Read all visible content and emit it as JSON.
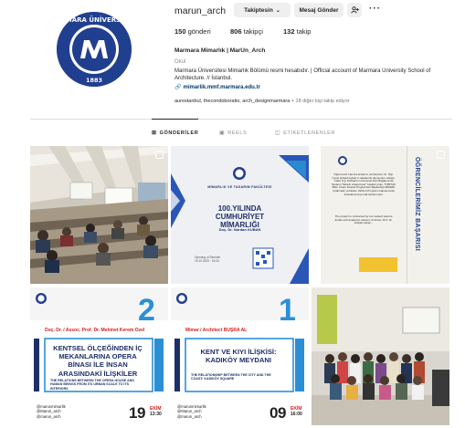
{
  "profile": {
    "username": "marun_arch",
    "follow_label": "Takiptesin",
    "message_label": "Mesaj Gönder",
    "add_user_icon": "add-user-icon",
    "more_label": "···",
    "stats": {
      "posts_count": "150",
      "posts_label": "gönderi",
      "followers_count": "806",
      "followers_label": "takipçi",
      "following_count": "132",
      "following_label": "takip"
    },
    "display_name": "Marmara Mimarlık | MarUn_Arch",
    "category": "Okul",
    "bio": "Marmara Üniversitesi Mimarlık Bölümü resmi hesabıdır. | Official account of Marmara University School of Architecture. // İstanbul.",
    "link": "mimarlik.mmf.marmara.edu.tr",
    "followed_by": "aurestanbul, thecondoboratio, arch_designmarmara",
    "followed_by_more": " + 18 diğer kişi takip ediyor"
  },
  "tabs": [
    {
      "label": "GÖNDERİLER",
      "icon": "grid-icon",
      "active": true
    },
    {
      "label": "REELS",
      "icon": "reels-icon",
      "active": false
    },
    {
      "label": "ETİKETLENENLER",
      "icon": "tagged-icon",
      "active": false
    }
  ],
  "posts": {
    "p2": {
      "faculty": "MİMARLIK VE TASARIM FAKÜLTESİ",
      "title_line1": "100.YILINDA",
      "title_line2": "CUMHURİYET",
      "title_line3": "MİMARLIĞI",
      "author": "Doç. Dr. Nurdan KUBAN",
      "date_line1": "Opening of Seminer",
      "date_line2": "19.10.2023 · 16:00"
    },
    "p3": {
      "vertical_title": "ÖĞRENCİLERİMİZ BAŞARISI",
      "body": "Öğrencimiz Hamza Arslan'ın yürütücüsü, Dr. Öğr. Üyesi Gülşah Aykaç'ın akademik danışmanı olduğu, \"Halic Kıyı Parklarının Kamusal Alan Bağlamında Tasarım Tabanlı Araştırması\" başlıklı proje, TÜBİTAK Bilim İnsanı Destek Programları Başkanlığı (BİDEB) tarafından yürütülen 2209-A Programı kapsamında desteklenmeye hak kazanmıştır.",
      "body_en": "The project is conducted by our student Hamza Arslan and academic advisor of Assist. Prof. Dr. Gülşah Aykaç..."
    },
    "p4": {
      "number": "2",
      "speaker": "Doç. Dr. / Assoc. Prof. Dr. Mehmet Kerem Özel",
      "title": "KENTSEL ÖLÇEĞİNDEN İÇ MEKANLARINA OPERA BİNASI İLE İNSAN ARASINDAKİ İLİŞKİLER",
      "subtitle": "THE RELATIONS BETWEEN THE OPERA HOUSE AND HUMAN BEINGS FROM ITS URBAN SCALE TO ITS INTERIORS",
      "social1": "@marunmimarlik",
      "social2": "@Marun_arch",
      "social3": "@marun_arch",
      "day": "19",
      "month": "EKİM",
      "time": "13:30"
    },
    "p5": {
      "number": "1",
      "speaker": "Mimar / Architect  BÜŞRA AL",
      "title": "KENT VE KIYI İLİŞKİSİ: KADIKÖY MEYDANI",
      "subtitle": "THE RELATIONSHIP BETWEEN THE CITY AND THE COAST: KADIKÖY SQUARE",
      "social1": "@marunmimarlik",
      "social2": "@Marun_arch",
      "social3": "@marun_arch",
      "day": "09",
      "month": "EKİM",
      "time": "16:00"
    }
  }
}
